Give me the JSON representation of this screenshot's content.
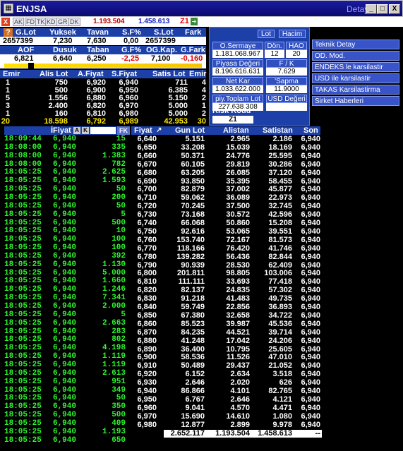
{
  "window": {
    "title": "ENJSA",
    "detay_label": "Detay",
    "btn_min": "_",
    "btn_max": "□",
    "btn_close": "X"
  },
  "toolbar": {
    "close_label": "X",
    "tabs": [
      "AK",
      "FD",
      "TK",
      "KD",
      "GR",
      "DK"
    ],
    "value_red": "1.193.504",
    "value_blue": "1.458.613",
    "z_label": "Z1"
  },
  "summary": {
    "row1_headers": [
      "G.Lot",
      "Yuksek",
      "Tavan",
      "S.F%",
      "S.Lot",
      "Fark"
    ],
    "row1_values": [
      "2657399",
      "7,230",
      "7,630",
      "0,00",
      "2657399",
      ""
    ],
    "row2_headers": [
      "AOF",
      "Dusuk",
      "Taban",
      "G.F%",
      "OG.Kap.",
      "G.Fark"
    ],
    "row2_values": [
      "6,821",
      "6,640",
      "6,250",
      "-2,25",
      "7,100",
      "-0,160"
    ],
    "help_icon": "?"
  },
  "right_panel": {
    "lot_btn": "Lot",
    "hacim_btn": "Hacim",
    "o_sermaye_label": "O.Sermaye",
    "o_sermaye_value": "1.181.068.967",
    "don_label": "Dön.",
    "don_value": "12",
    "hao_label": "HAO",
    "hao_value": "20",
    "piyasa_label": "Piyasa Değeri",
    "piyasa_value": "8.196.616.631",
    "fk_label": "F / K",
    "fk_value": "7.629",
    "net_kar_label": "Net Kar",
    "net_kar_value": "1.033.622.000",
    "sapma_label": "'Sapma",
    "sapma_value": "11.9000",
    "toplam_lot_label": "piy.Toplam Lot",
    "toplam_lot_value": "227.638.308",
    "usd_label": "USD Değeri",
    "usd_value": "",
    "risk_label": "Risk Kodu",
    "risk_value": "Z1"
  },
  "menu": [
    "Teknik Detay",
    "OD. Mod.",
    "ENDEKS le karsilastir",
    "USD ile karsilastir",
    "TAKAS Karsilastirma",
    "Sirket Haberleri"
  ],
  "emir": {
    "headers": [
      "Emir",
      "Alis Lot",
      "A.Fiyat",
      "S.Fiyat",
      "Satis Lot",
      "Emir"
    ],
    "rows": [
      [
        "1",
        "750",
        "6,920",
        "6,940",
        "711",
        "4"
      ],
      [
        "1",
        "500",
        "6,900",
        "6,950",
        "6.385",
        "4"
      ],
      [
        "5",
        "1.556",
        "6,880",
        "6,960",
        "5.150",
        "2"
      ],
      [
        "3",
        "2.400",
        "6,820",
        "6,970",
        "5.000",
        "1"
      ],
      [
        "1",
        "160",
        "6,810",
        "6,980",
        "5.000",
        "2"
      ]
    ],
    "total": [
      "20",
      "18.598",
      "6,792",
      "6,989",
      "42.953",
      "30"
    ]
  },
  "trades": {
    "header_fiyat": "İFiyat",
    "btn_a": "A",
    "btn_k": "K",
    "btn_fk": "FK",
    "rows": [
      [
        "18:09:44",
        "6,940",
        "15"
      ],
      [
        "18:08:00",
        "6,940",
        "335"
      ],
      [
        "18:08:00",
        "6,940",
        "1.383"
      ],
      [
        "18:08:00",
        "6,940",
        "782"
      ],
      [
        "18:05:25",
        "6,940",
        "2.625"
      ],
      [
        "18:05:25",
        "6,940",
        "1.593"
      ],
      [
        "18:05:25",
        "6,940",
        "50"
      ],
      [
        "18:05:25",
        "6,940",
        "200"
      ],
      [
        "18:05:25",
        "6,940",
        "50"
      ],
      [
        "18:05:25",
        "6,940",
        "5"
      ],
      [
        "18:05:25",
        "6,940",
        "500"
      ],
      [
        "18:05:25",
        "6,940",
        "10"
      ],
      [
        "18:05:25",
        "6,940",
        "100"
      ],
      [
        "18:05:25",
        "6,940",
        "100"
      ],
      [
        "18:05:25",
        "6,940",
        "392"
      ],
      [
        "18:05:25",
        "6,940",
        "1.130"
      ],
      [
        "18:05:25",
        "6,940",
        "5.000"
      ],
      [
        "18:05:25",
        "6,940",
        "1.660"
      ],
      [
        "18:05:25",
        "6,940",
        "1.246"
      ],
      [
        "18:05:25",
        "6,940",
        "7.341"
      ],
      [
        "18:05:25",
        "6,940",
        "2.000"
      ],
      [
        "18:05:25",
        "6,940",
        "5"
      ],
      [
        "18:05:25",
        "6,940",
        "2.663"
      ],
      [
        "18:05:25",
        "6,940",
        "283"
      ],
      [
        "18:05:25",
        "6,940",
        "802"
      ],
      [
        "18:05:25",
        "6,940",
        "4.198"
      ],
      [
        "18:05:25",
        "6,940",
        "1.119"
      ],
      [
        "18:05:25",
        "6,940",
        "1.119"
      ],
      [
        "18:05:25",
        "6,940",
        "2.613"
      ],
      [
        "18:05:25",
        "6,940",
        "951"
      ],
      [
        "18:05:25",
        "6,940",
        "349"
      ],
      [
        "18:05:25",
        "6,940",
        "50"
      ],
      [
        "18:05:25",
        "6,940",
        "350"
      ],
      [
        "18:05:25",
        "6,940",
        "500"
      ],
      [
        "18:05:25",
        "6,940",
        "409"
      ],
      [
        "18:05:25",
        "6,940",
        "1.193"
      ],
      [
        "18:05:25",
        "6,940",
        "650"
      ]
    ]
  },
  "depth": {
    "headers": [
      "Fiyat",
      "Gun Lot",
      "Alistan",
      "Satistan",
      "Son"
    ],
    "rows": [
      [
        "6,640",
        "5.151",
        "2.965",
        "2.186",
        "6,940"
      ],
      [
        "6,650",
        "33.208",
        "15.039",
        "18.169",
        "6,940"
      ],
      [
        "6,660",
        "50.371",
        "24.776",
        "25.595",
        "6,940"
      ],
      [
        "6,670",
        "60.105",
        "29.819",
        "30.286",
        "6,940"
      ],
      [
        "6,680",
        "63.205",
        "26.085",
        "37.120",
        "6,940"
      ],
      [
        "6,690",
        "93.850",
        "35.395",
        "58.455",
        "6,940"
      ],
      [
        "6,700",
        "82.879",
        "37.002",
        "45.877",
        "6,940"
      ],
      [
        "6,710",
        "59.062",
        "36.089",
        "22.973",
        "6,940"
      ],
      [
        "6,720",
        "70.245",
        "37.500",
        "32.745",
        "6,940"
      ],
      [
        "6,730",
        "73.168",
        "30.572",
        "42.596",
        "6,940"
      ],
      [
        "6,740",
        "66.068",
        "50.860",
        "15.208",
        "6,940"
      ],
      [
        "6,750",
        "92.616",
        "53.065",
        "39.551",
        "6,940"
      ],
      [
        "6,760",
        "153.740",
        "72.167",
        "81.573",
        "6,940"
      ],
      [
        "6,770",
        "118.166",
        "76.420",
        "41.746",
        "6,940"
      ],
      [
        "6,780",
        "139.282",
        "56.436",
        "82.844",
        "6,940"
      ],
      [
        "6,790",
        "90.939",
        "28.530",
        "62.409",
        "6,940"
      ],
      [
        "6,800",
        "201.811",
        "98.805",
        "103.006",
        "6,940"
      ],
      [
        "6,810",
        "111.111",
        "33.693",
        "77.418",
        "6,940"
      ],
      [
        "6,820",
        "82.137",
        "24.835",
        "57.302",
        "6,940"
      ],
      [
        "6,830",
        "91.218",
        "41.483",
        "49.735",
        "6,940"
      ],
      [
        "6,840",
        "59.749",
        "22.856",
        "36.893",
        "6,940"
      ],
      [
        "6,850",
        "67.380",
        "32.658",
        "34.722",
        "6,940"
      ],
      [
        "6,860",
        "85.523",
        "39.987",
        "45.536",
        "6,940"
      ],
      [
        "6,870",
        "84.235",
        "44.521",
        "39.714",
        "6,940"
      ],
      [
        "6,880",
        "41.248",
        "17.042",
        "24.206",
        "6,940"
      ],
      [
        "6,890",
        "36.400",
        "10.795",
        "25.605",
        "6,940"
      ],
      [
        "6,900",
        "58.536",
        "11.526",
        "47.010",
        "6,940"
      ],
      [
        "6,910",
        "50.489",
        "29.437",
        "21.052",
        "6,940"
      ],
      [
        "6,920",
        "6.152",
        "2.634",
        "3.518",
        "6,940"
      ],
      [
        "6,930",
        "2.646",
        "2.020",
        "626",
        "6,940"
      ],
      [
        "6,940",
        "86.866",
        "4.101",
        "82.765",
        "6,940"
      ],
      [
        "6,950",
        "6.767",
        "2.646",
        "4.121",
        "6,940"
      ],
      [
        "6,960",
        "9.041",
        "4.570",
        "4.471",
        "6,940"
      ],
      [
        "6,970",
        "15.690",
        "14.610",
        "1.080",
        "6,940"
      ],
      [
        "6,980",
        "12.877",
        "2.899",
        "9.978",
        "6,940"
      ]
    ],
    "total": [
      "",
      "2.652.117",
      "1.193.504",
      "1.458.613",
      "--"
    ]
  },
  "colors": {
    "title_bg": "#0a0a6e",
    "header_blue": "#1c40a8",
    "trade_green": "#2df52d",
    "highlight_yellow": "#ffea00",
    "negative_red": "#e00000"
  }
}
